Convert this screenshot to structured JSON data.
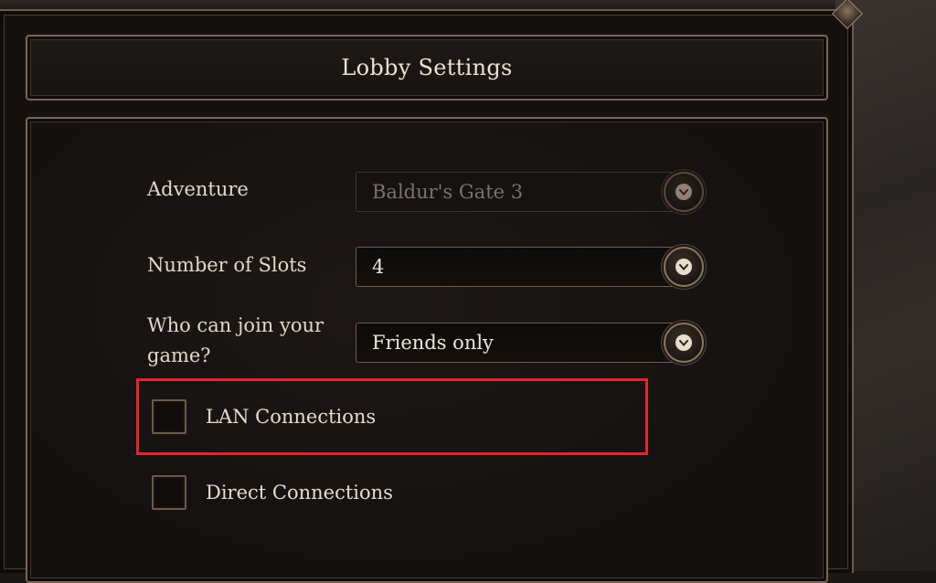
{
  "window": {
    "title": "Lobby Settings"
  },
  "settings": {
    "adventure": {
      "label": "Adventure",
      "value": "Baldur's Gate 3",
      "disabled": true
    },
    "slots": {
      "label": "Number of Slots",
      "value": "4"
    },
    "join": {
      "label_line1": "Who can join your",
      "label_line2": "game?",
      "value": "Friends only"
    },
    "lan": {
      "label": "LAN Connections",
      "checked": false
    },
    "direct": {
      "label": "Direct Connections",
      "checked": false
    }
  },
  "icons": {
    "dropdown": "chevron-down-icon"
  },
  "colors": {
    "highlight": "#e3252c",
    "frame": "#7a6652",
    "text": "#e6dccb"
  }
}
